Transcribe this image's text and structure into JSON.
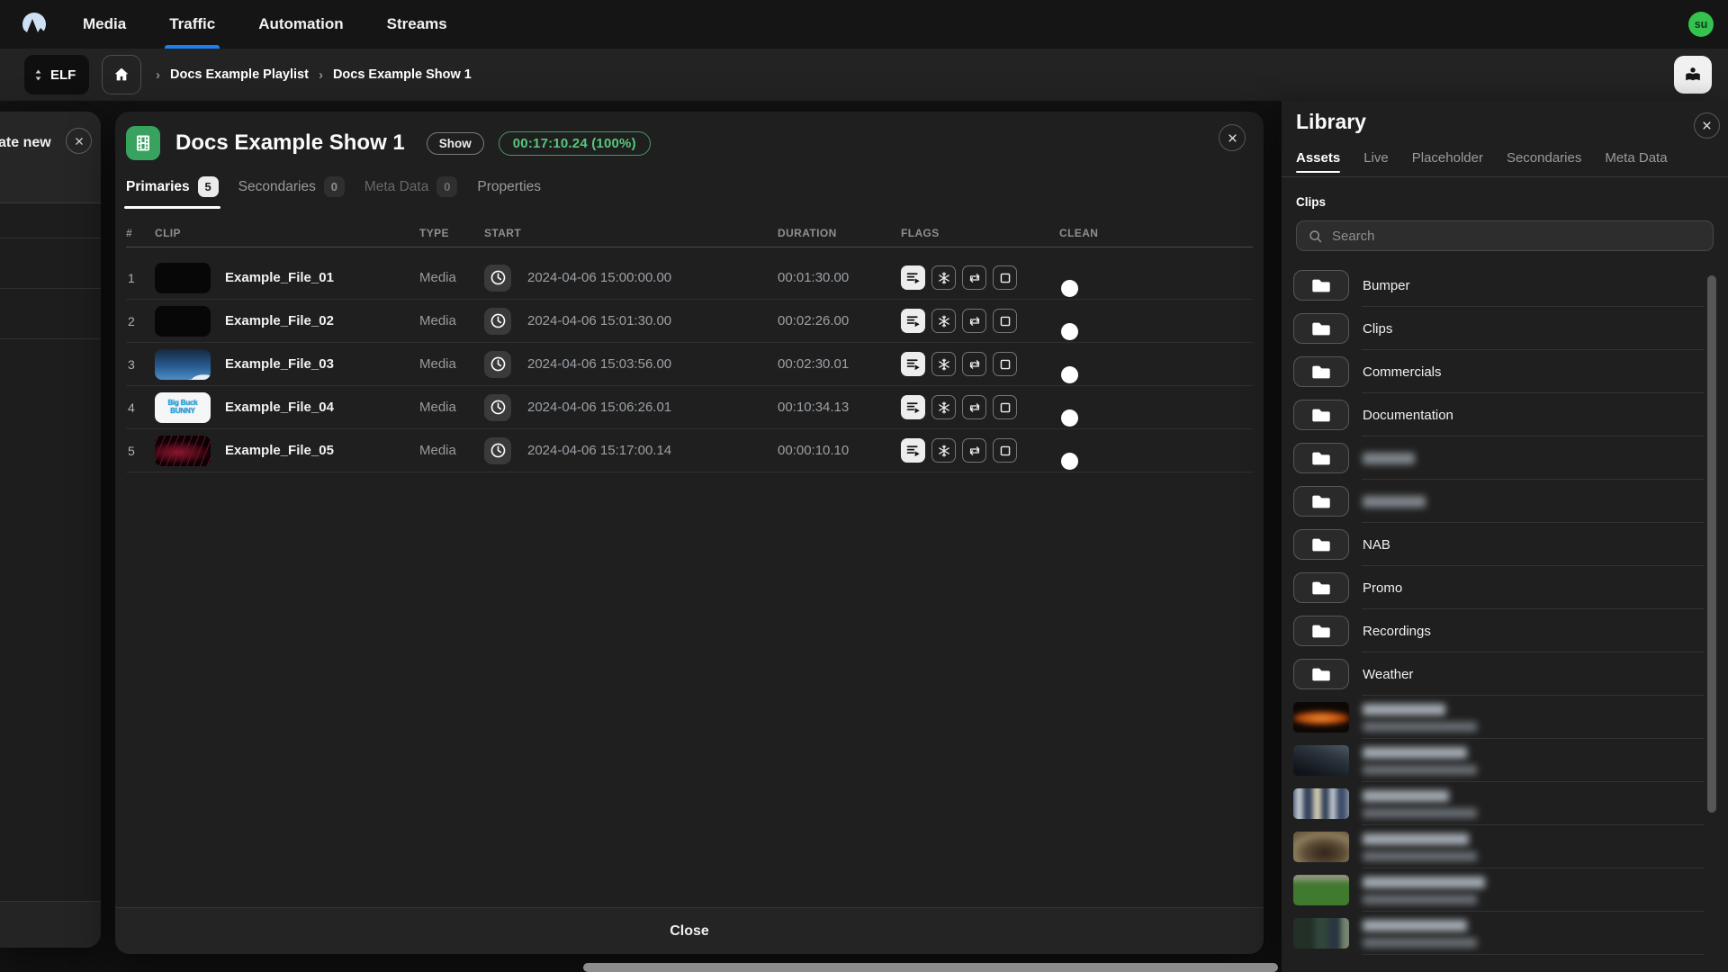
{
  "nav": {
    "logo": "elf-mountain-logo",
    "items": [
      {
        "label": "Media"
      },
      {
        "label": "Traffic",
        "active": true
      },
      {
        "label": "Automation"
      },
      {
        "label": "Streams"
      }
    ],
    "avatar_initials": "su"
  },
  "breadcrumb_bar": {
    "workspace": "ELF",
    "crumbs": [
      {
        "label": "Docs Example Playlist"
      },
      {
        "label": "Docs Example Show 1"
      }
    ]
  },
  "left_panel": {
    "title_partial": "ate new"
  },
  "show_modal": {
    "title": "Docs Example Show 1",
    "type_pill": "Show",
    "duration_badge": "00:17:10.24 (100%)",
    "tabs": [
      {
        "label": "Primaries",
        "count": "5",
        "active": true
      },
      {
        "label": "Secondaries",
        "count": "0"
      },
      {
        "label": "Meta Data",
        "count": "0",
        "muted": true
      },
      {
        "label": "Properties"
      }
    ],
    "table": {
      "columns": [
        "#",
        "CLIP",
        "TYPE",
        "START",
        "DURATION",
        "FLAGS",
        "CLEAN"
      ],
      "flag_icons": [
        "playlist-play",
        "snowflake",
        "repeat",
        "frame"
      ],
      "rows": [
        {
          "num": "1",
          "name": "Example_File_01",
          "type": "Media",
          "start": "2024-04-06 15:00:00.00",
          "duration": "00:01:30.00",
          "thumb": "black",
          "clean": false
        },
        {
          "num": "2",
          "name": "Example_File_02",
          "type": "Media",
          "start": "2024-04-06 15:01:30.00",
          "duration": "00:02:26.00",
          "thumb": "black",
          "clean": false
        },
        {
          "num": "3",
          "name": "Example_File_03",
          "type": "Media",
          "start": "2024-04-06 15:03:56.00",
          "duration": "00:02:30.01",
          "thumb": "sky",
          "clean": false
        },
        {
          "num": "4",
          "name": "Example_File_04",
          "type": "Media",
          "start": "2024-04-06 15:06:26.01",
          "duration": "00:10:34.13",
          "thumb": "bunny",
          "thumb_text": "Big Buck\nBUNNY",
          "clean": false
        },
        {
          "num": "5",
          "name": "Example_File_05",
          "type": "Media",
          "start": "2024-04-06 15:17:00.14",
          "duration": "00:00:10.10",
          "thumb": "red",
          "clean": false
        }
      ]
    },
    "footer": {
      "close_label": "Close"
    }
  },
  "library": {
    "title": "Library",
    "tabs": [
      {
        "label": "Assets",
        "active": true
      },
      {
        "label": "Live"
      },
      {
        "label": "Placeholder"
      },
      {
        "label": "Secondaries"
      },
      {
        "label": "Meta Data"
      }
    ],
    "section_label": "Clips",
    "search_placeholder": "Search",
    "folders": [
      {
        "label": "Bumper"
      },
      {
        "label": "Clips"
      },
      {
        "label": "Commercials"
      },
      {
        "label": "Documentation"
      },
      {
        "label": "",
        "redacted": true
      },
      {
        "label": "",
        "redacted": true
      },
      {
        "label": "NAB"
      },
      {
        "label": "Promo"
      },
      {
        "label": "Recordings"
      },
      {
        "label": "Weather"
      }
    ],
    "assets": [
      {
        "thumb": "fire",
        "redacted": true
      },
      {
        "thumb": "night",
        "redacted": true
      },
      {
        "thumb": "room",
        "redacted": true
      },
      {
        "thumb": "cabin",
        "redacted": true
      },
      {
        "thumb": "pitch",
        "redacted": true
      },
      {
        "thumb": "teal",
        "redacted": true
      }
    ]
  },
  "colors": {
    "accent_blue": "#1d7ef2",
    "brand_green": "#38a35f",
    "duration_green": "#56c77c",
    "avatar_green": "#35c24e"
  }
}
